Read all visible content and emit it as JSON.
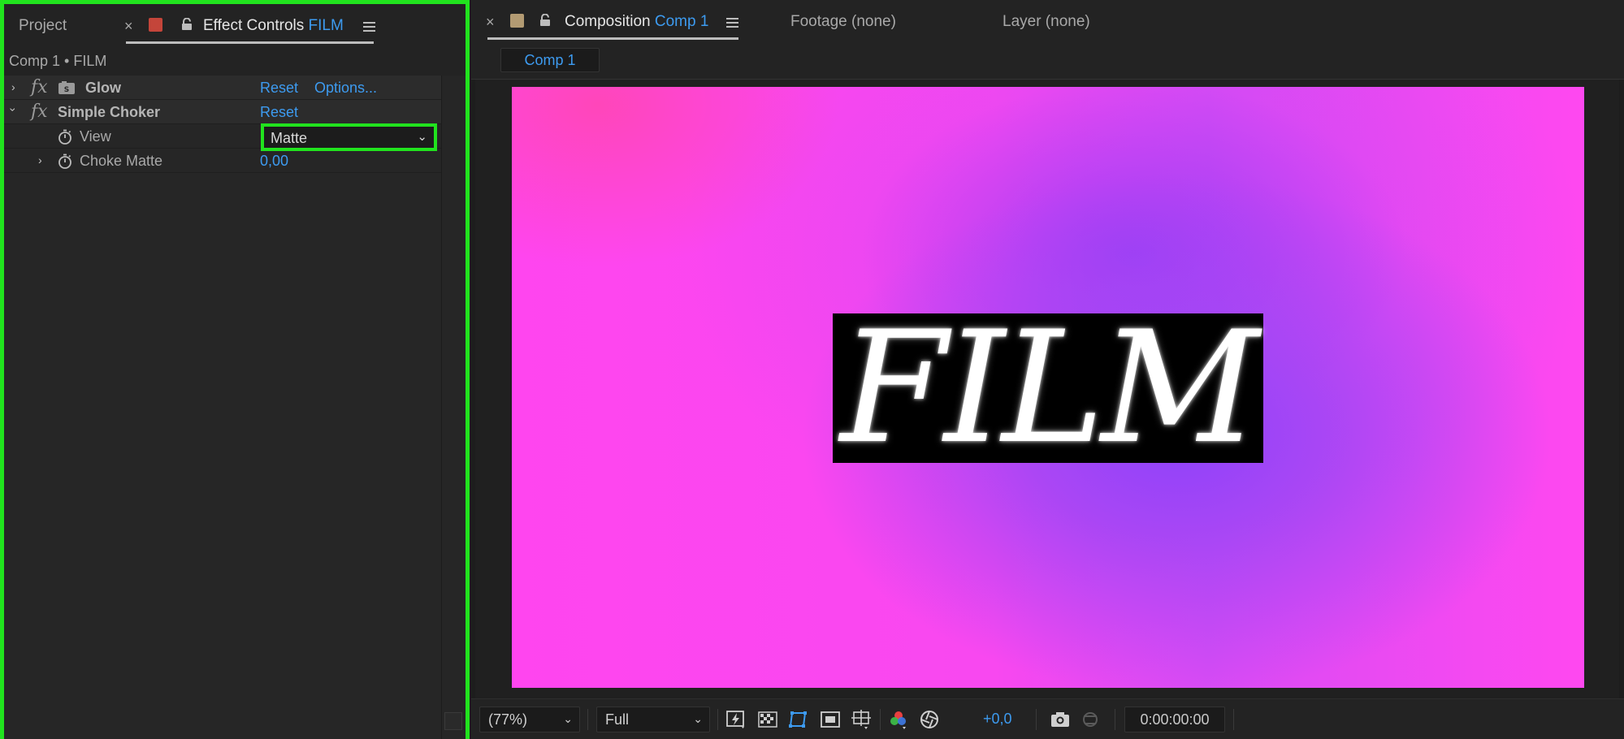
{
  "left_panel": {
    "tabs": {
      "project": "Project",
      "effect_controls_prefix": "Effect Controls",
      "effect_controls_layer": "FILM"
    },
    "breadcrumb": "Comp 1 • FILM",
    "effects": [
      {
        "name": "Glow",
        "reset": "Reset",
        "options": "Options..."
      },
      {
        "name": "Simple Choker",
        "reset": "Reset"
      }
    ],
    "properties": {
      "view_label": "View",
      "view_value": "Matte",
      "choke_label": "Choke Matte",
      "choke_value": "0,00"
    },
    "label_color": "#c4453a",
    "highlight_color": "#21e31e"
  },
  "right_panel": {
    "tabs": {
      "composition_prefix": "Composition",
      "composition_name": "Comp 1",
      "footage": "Footage (none)",
      "layer": "Layer (none)"
    },
    "subtab": "Comp 1",
    "label_color": "#b39b73",
    "canvas_text": "FILM",
    "bottom": {
      "zoom": "(77%)",
      "resolution": "Full",
      "exposure": "+0,0",
      "timecode": "0:00:00:00"
    }
  },
  "icons": [
    "close-icon",
    "lock-icon",
    "panel-menu-icon",
    "chevron-right-icon",
    "chevron-down-icon",
    "fx-icon",
    "glow-plugin-icon",
    "stopwatch-icon",
    "fast-preview-icon",
    "transparency-grid-icon",
    "mask-visibility-icon",
    "region-of-interest-icon",
    "guides-icon",
    "color-channel-icon",
    "color-management-icon",
    "snapshot-icon",
    "show-snapshot-icon"
  ]
}
